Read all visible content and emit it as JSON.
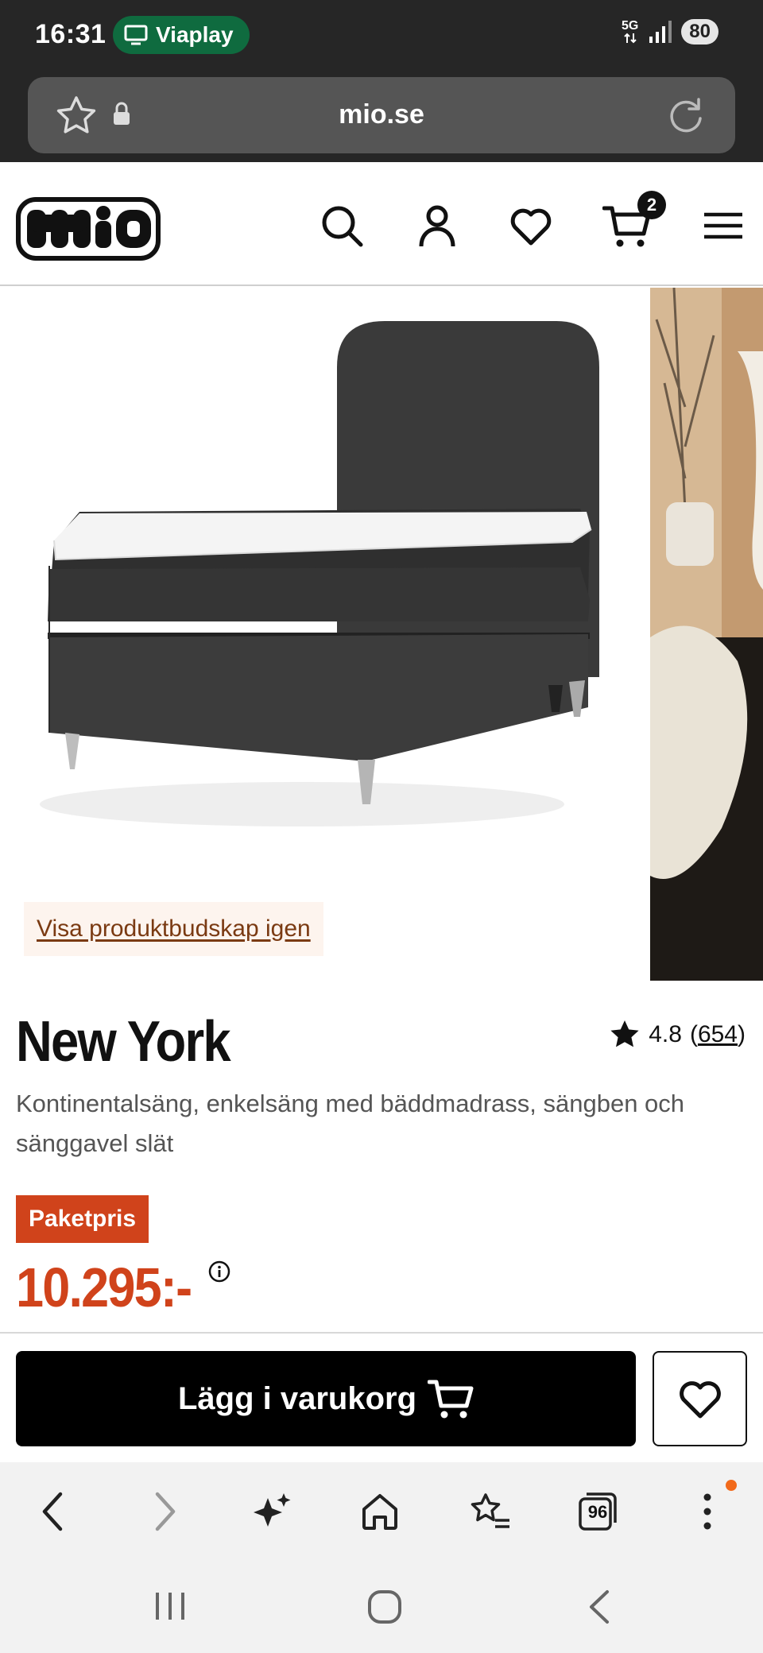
{
  "status_bar": {
    "time": "16:31",
    "viaplay_label": "Viaplay",
    "network_label": "5G",
    "battery": "80"
  },
  "browser": {
    "url": "mio.se",
    "tabs_count": "96"
  },
  "product": {
    "restore_link": "Visa produktbudskap igen",
    "title": "New York",
    "rating_value": "4.8",
    "rating_open": "(",
    "rating_count": "654",
    "rating_close": ")",
    "description": "Kontinentalsäng, enkelsäng med bäddmadrass, sängben och sänggavel slät",
    "badge": "Paketpris",
    "price": "10.295:-"
  },
  "header": {
    "cart_count": "2"
  },
  "actions": {
    "add_to_cart_label": "Lägg i varukorg"
  },
  "colors": {
    "accent_orange": "#d0431b",
    "status_green": "#0f6b3f",
    "dark_bar": "#262626"
  }
}
